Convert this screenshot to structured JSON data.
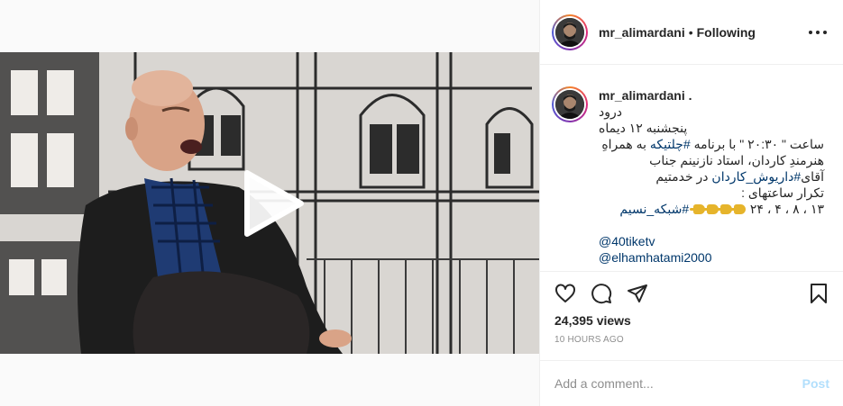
{
  "post": {
    "username": "mr_alimardani",
    "separator": "•",
    "follow_status": "Following"
  },
  "caption": {
    "username": "mr_alimardani .",
    "lines": [
      "درود",
      "پنجشنبه ۱۲ دیماه",
      "ساعت \" ۲۰:۳۰ \" با برنامه",
      "هنرمندِ کاردان، استاد نازنینم جناب",
      "آقای",
      "در خدمتیم",
      "تکرار ساعتهای :",
      "۱۳ ، ۸ ، ۴ ، ۲۴"
    ],
    "hashtags": {
      "program": "#چلتیکه",
      "program_suffix": "به همراهِ",
      "guest": "#داریوش_کاردان",
      "network": "#شبکه_نسیم"
    },
    "mentions": [
      "@40tiketv",
      "@elhamhatami2000"
    ]
  },
  "stats": {
    "views": "24,395 views",
    "time_ago": "10 HOURS AGO"
  },
  "comment": {
    "placeholder": "Add a comment...",
    "post_label": "Post"
  },
  "icons": {
    "play": "play-icon",
    "like": "heart-icon",
    "comment": "comment-icon",
    "share": "send-icon",
    "save": "bookmark-icon",
    "more": "more-options-icon"
  },
  "colors": {
    "link": "#00376b",
    "post_button": "#b2dffc",
    "muted": "#8e8e8e",
    "text": "#262626"
  }
}
